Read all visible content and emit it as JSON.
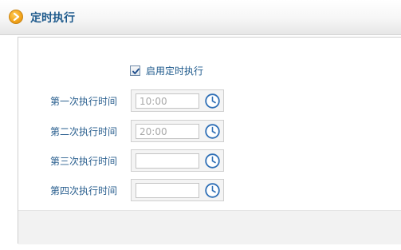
{
  "header": {
    "title": "定时执行",
    "icon": "chevron-right-icon"
  },
  "enable": {
    "label": "启用定时执行",
    "checked": true
  },
  "times": [
    {
      "label": "第一次执行时间",
      "value": "10:00",
      "icon": "clock-icon"
    },
    {
      "label": "第二次执行时间",
      "value": "20:00",
      "icon": "clock-icon"
    },
    {
      "label": "第三次执行时间",
      "value": "",
      "icon": "clock-icon"
    },
    {
      "label": "第四次执行时间",
      "value": "",
      "icon": "clock-icon"
    }
  ],
  "colors": {
    "label_text": "#2a5f8f",
    "title_text": "#1e5a8c",
    "icon_orange": "#f1a21a",
    "clock_blue": "#2f6fb6"
  }
}
